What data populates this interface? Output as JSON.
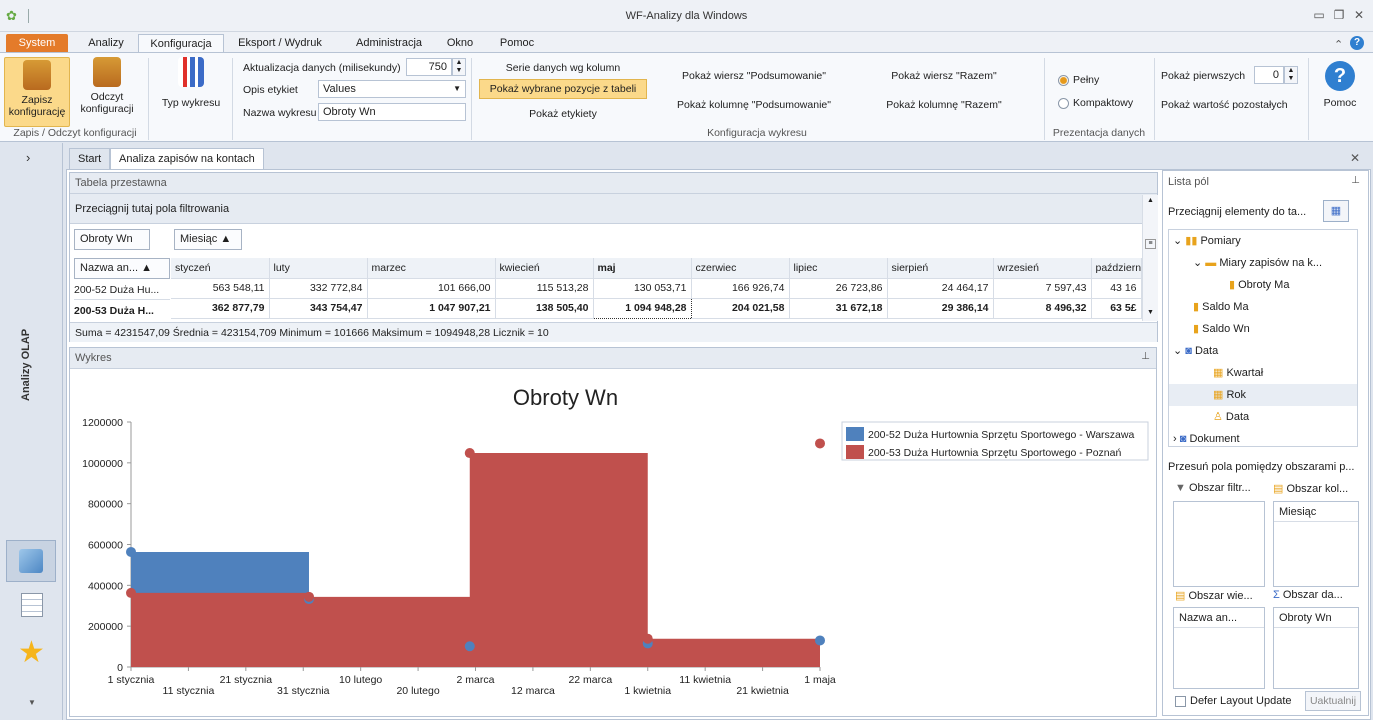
{
  "window": {
    "title": "WF-Analizy dla Windows"
  },
  "menu": {
    "tabs": [
      "System",
      "Analizy",
      "Konfiguracja",
      "Eksport / Wydruk",
      "Administracja",
      "Okno",
      "Pomoc"
    ]
  },
  "ribbon": {
    "save": "Zapisz konfigurację",
    "read": "Odczyt konfiguracji",
    "group_saveread": "Zapis / Odczyt konfiguracji",
    "chart_type": "Typ wykresu",
    "refresh_label": "Aktualizacja danych (milisekundy)",
    "refresh_value": "750",
    "labels_label": "Opis etykiet",
    "labels_value": "Values",
    "chart_name_label": "Nazwa wykresu",
    "chart_name_value": "Obroty Wn",
    "series_cols": "Serie danych wg kolumn",
    "show_selected": "Pokaż wybrane pozycje z tabeli",
    "show_labels": "Pokaż etykiety",
    "row_summary": "Pokaż wiersz \"Podsumowanie\"",
    "col_summary": "Pokaż kolumnę \"Podsumowanie\"",
    "row_total": "Pokaż wiersz \"Razem\"",
    "col_total": "Pokaż kolumnę \"Razem\"",
    "group_chartconf": "Konfiguracja wykresu",
    "full": "Pełny",
    "compact": "Kompaktowy",
    "group_presentation": "Prezentacja danych",
    "show_first": "Pokaż pierwszych",
    "show_first_value": "0",
    "show_rest": "Pokaż wartość pozostałych",
    "help": "Pomoc"
  },
  "doc_tabs": [
    "Start",
    "Analiza zapisów na kontach"
  ],
  "side": {
    "label": "Analizy OLAP"
  },
  "pivot": {
    "title": "Tabela przestawna",
    "filter_hint": "Przeciągnij tutaj pola filtrowania",
    "data_field": "Obroty Wn",
    "col_field": "Miesiąc ▲",
    "row_field": "Nazwa an... ▲",
    "months": [
      "styczeń",
      "luty",
      "marzec",
      "kwiecień",
      "maj",
      "czerwiec",
      "lipiec",
      "sierpień",
      "wrzesień",
      "październik"
    ],
    "rows": [
      {
        "name": "200-52 Duża Hu...",
        "values": [
          "563 548,11",
          "332 772,84",
          "101 666,00",
          "115 513,28",
          "130 053,71",
          "166 926,74",
          "26 723,86",
          "24 464,17",
          "7 597,43",
          "43 16"
        ]
      },
      {
        "name": "200-53 Duża H...",
        "values": [
          "362 877,79",
          "343 754,47",
          "1 047 907,21",
          "138 505,40",
          "1 094 948,28",
          "204 021,58",
          "31 672,18",
          "29 386,14",
          "8 496,32",
          "63 5£"
        ]
      }
    ],
    "summary": "Suma = 4231547,09  Średnia = 423154,709  Minimum = 101666  Maksimum = 1094948,28  Licznik = 10"
  },
  "chart_panel": {
    "title": "Wykres"
  },
  "chart_data": {
    "type": "area",
    "title": "Obroty Wn",
    "ylim": [
      0,
      1200000
    ],
    "yticks": [
      "0",
      "200000",
      "400000",
      "600000",
      "800000",
      "1000000",
      "1200000"
    ],
    "xticks_top": [
      "1 stycznia",
      "21 stycznia",
      "10 lutego",
      "2 marca",
      "22 marca",
      "11 kwietnia",
      "1 maja"
    ],
    "xticks_bottom": [
      "11 stycznia",
      "31 stycznia",
      "20 lutego",
      "12 marca",
      "1 kwietnia",
      "21 kwietnia"
    ],
    "x": [
      "1 stycznia",
      "1 lutego",
      "1 marca",
      "1 kwietnia",
      "1 maja"
    ],
    "series": [
      {
        "name": "200-52 Duża Hurtownia Sprzętu Sportowego - Warszawa",
        "color": "#4f81bd",
        "values": [
          563548.11,
          332772.84,
          101666.0,
          115513.28,
          130053.71
        ]
      },
      {
        "name": "200-53 Duża Hurtownia Sprzętu Sportowego - Poznań",
        "color": "#c0504d",
        "values": [
          362877.79,
          343754.47,
          1047907.21,
          138505.4,
          1094948.28
        ]
      }
    ]
  },
  "fieldlist": {
    "title": "Lista pól",
    "drag_hint": "Przeciągnij elementy do ta...",
    "tree": [
      "Pomiary",
      "Miary zapisów na k...",
      "Obroty Ma",
      "Saldo Ma",
      "Saldo Wn",
      "Data",
      "Kwartał",
      "Rok",
      "Data",
      "Dokument"
    ],
    "move_hint": "Przesuń pola pomiędzy obszarami p...",
    "filter_area": "Obszar filtr...",
    "col_area": "Obszar kol...",
    "row_area": "Obszar wie...",
    "data_area": "Obszar da...",
    "col_field": "Miesiąc",
    "row_field": "Nazwa an...",
    "data_field": "Obroty Wn",
    "defer": "Defer Layout Update",
    "update": "Uaktualnij"
  }
}
